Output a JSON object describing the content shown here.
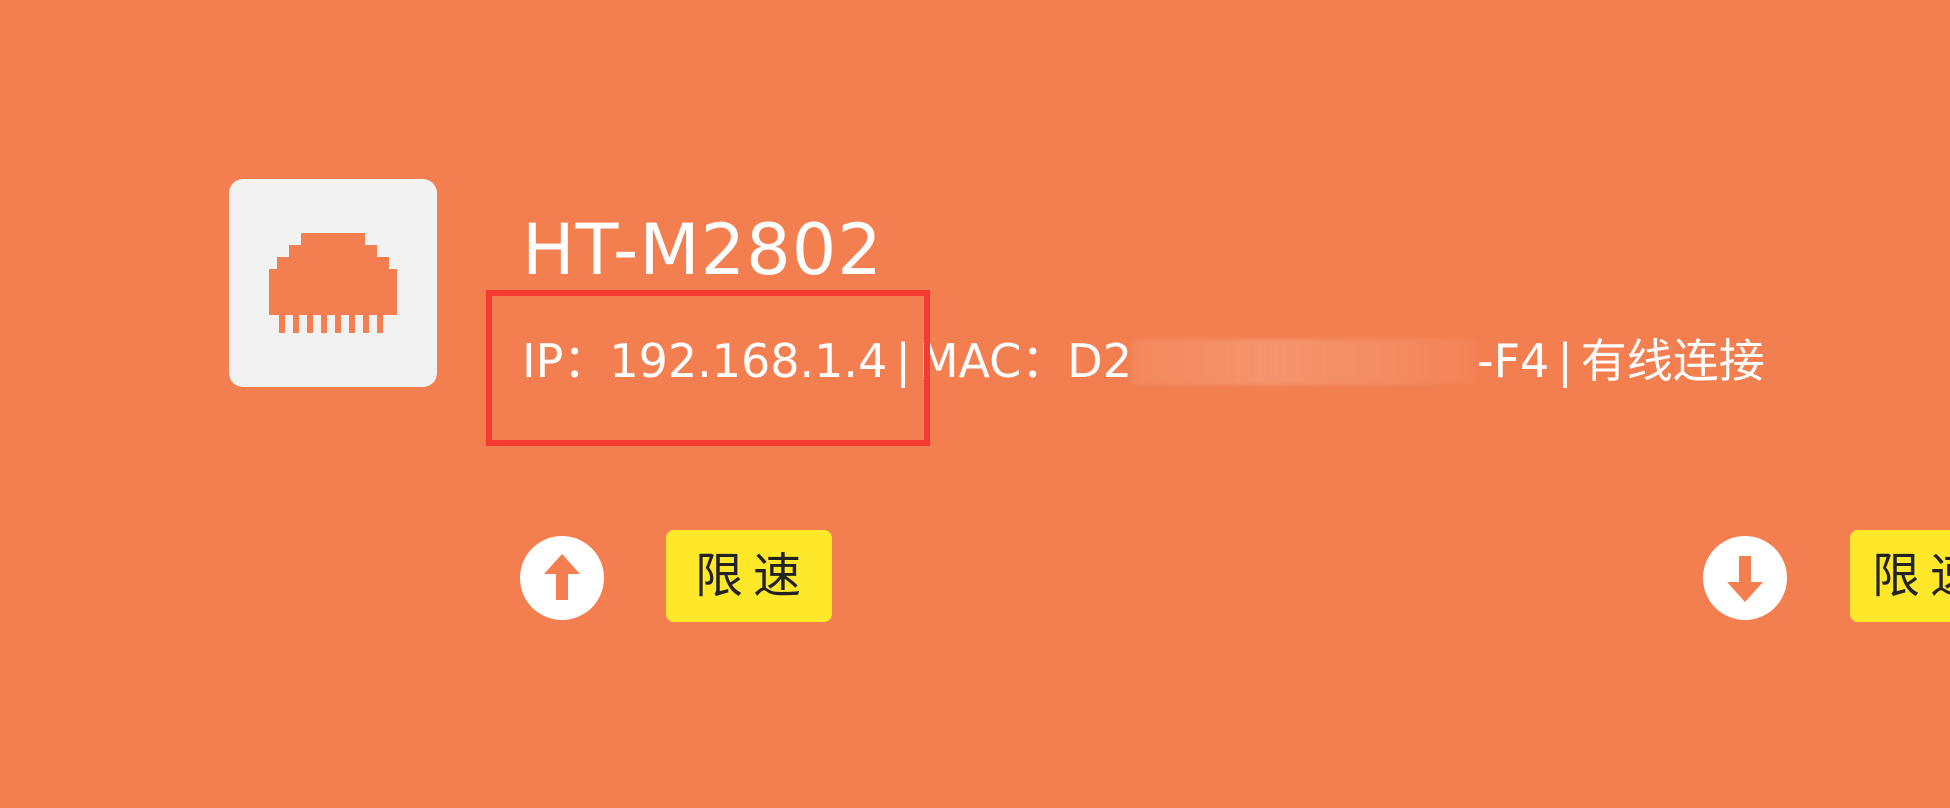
{
  "device": {
    "name": "HT-M2802",
    "ip_label": "IP：",
    "ip_value": "192.168.1.4",
    "separator": "|",
    "mac_label": "MAC：",
    "mac_prefix": "D2",
    "mac_suffix": "-F4",
    "connection_type": "有线连接",
    "icon": "ethernet-port-icon"
  },
  "rate_limit": {
    "upload_icon": "upload-arrow-icon",
    "upload_label": "限速",
    "download_icon": "download-arrow-icon",
    "download_label": "限速"
  },
  "colors": {
    "background": "#f37e4f",
    "highlight": "#f53a34",
    "button": "#ffe82a",
    "icon_box": "#f2f2f2"
  }
}
